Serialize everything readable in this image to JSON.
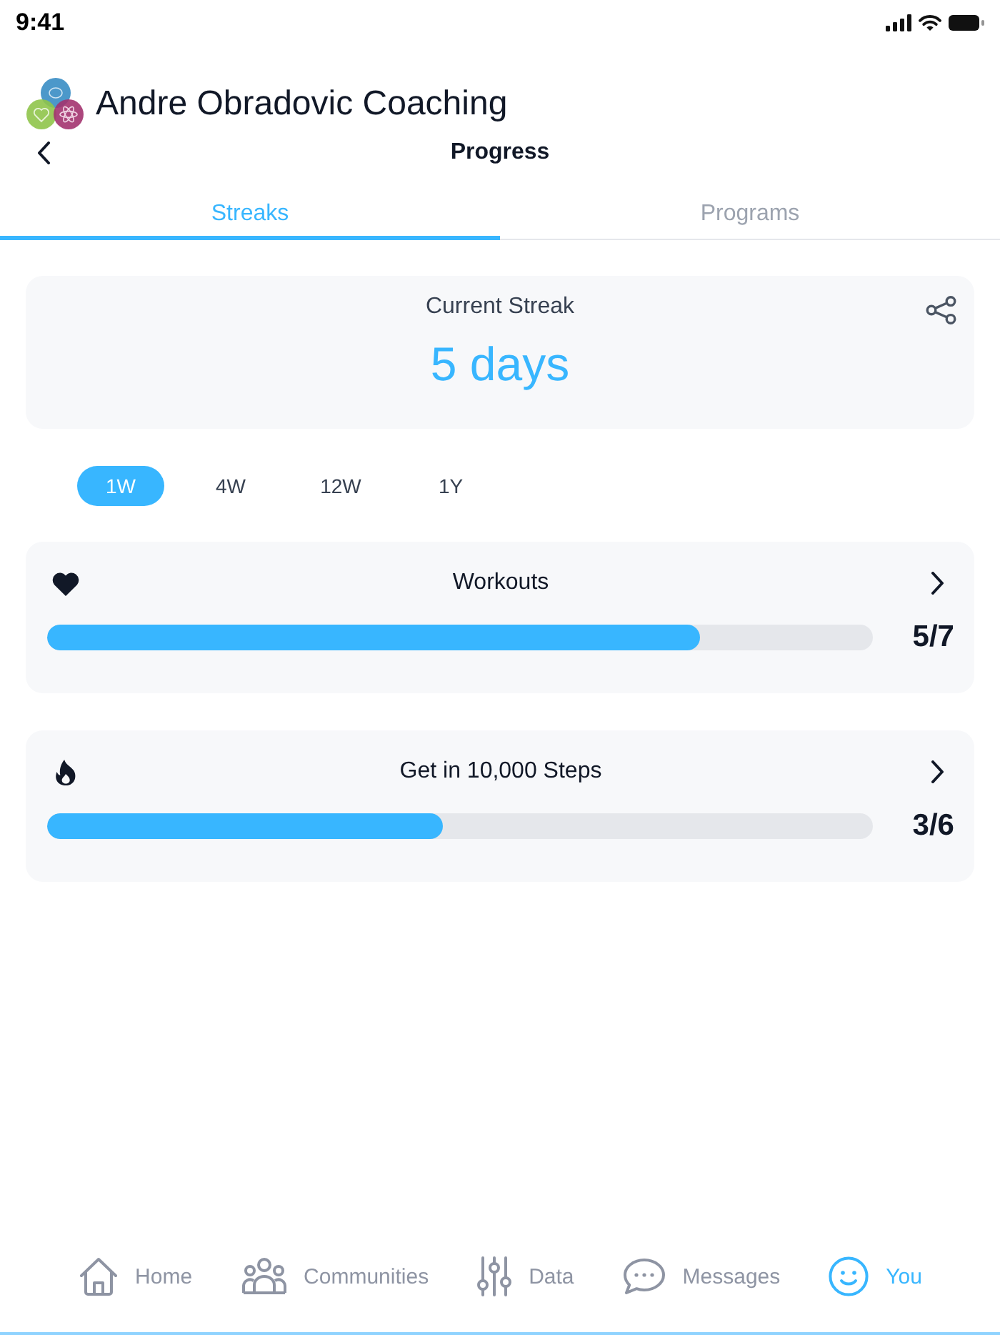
{
  "status_bar": {
    "time": "9:41"
  },
  "header": {
    "brand": "Andre Obradovic Coaching",
    "title": "Progress"
  },
  "tabs": [
    {
      "label": "Streaks",
      "selected": true
    },
    {
      "label": "Programs",
      "selected": false
    }
  ],
  "streak_card": {
    "label": "Current Streak",
    "value": "5 days"
  },
  "periods": [
    {
      "label": "1W",
      "selected": true
    },
    {
      "label": "4W",
      "selected": false
    },
    {
      "label": "12W",
      "selected": false
    },
    {
      "label": "1Y",
      "selected": false
    }
  ],
  "goals": [
    {
      "kind": "heart",
      "title": "Workouts",
      "level": 0.79,
      "count": "5/7"
    },
    {
      "kind": "flame",
      "title": "Get in 10,000 Steps",
      "level": 0.48,
      "count": "3/6"
    }
  ],
  "bottom_nav": [
    {
      "kind": "home",
      "label": "Home",
      "selected": false
    },
    {
      "kind": "communities",
      "label": "Communities",
      "selected": false
    },
    {
      "kind": "data",
      "label": "Data",
      "selected": false
    },
    {
      "kind": "messages",
      "label": "Messages",
      "selected": false
    },
    {
      "kind": "you",
      "label": "You",
      "selected": true
    }
  ]
}
